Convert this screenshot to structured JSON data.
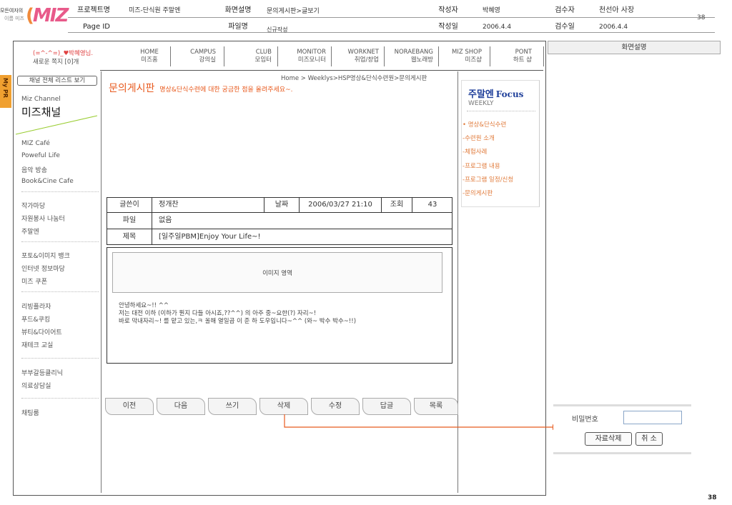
{
  "logo": {
    "line1": "모든여자의",
    "line2": "이름 미즈",
    "mark": "MIZ"
  },
  "spec": {
    "project_label": "프로젝트명",
    "project_value": "미즈-단식원 주말엔",
    "screen_label": "화면설명",
    "screen_value": "문의게시판>글보기",
    "author_label": "작성자",
    "author_value": "박혜영",
    "reviewer_label": "검수자",
    "reviewer_value": "천선아 사장",
    "page_id_label": "Page ID",
    "file_label": "파일명",
    "file_value": "신규작성",
    "date_label": "작성일",
    "date_value": "2006.4.4",
    "review_date_label": "검수일",
    "review_date_value": "2006.4.4",
    "page_number": "38"
  },
  "user": {
    "greeting": "(=^-^=)_♥박혜영님.",
    "messages": "새로운 쪽지 [0]개"
  },
  "nav": [
    {
      "en": "HOME",
      "ko": "미즈홈"
    },
    {
      "en": "CAMPUS",
      "ko": "강의실"
    },
    {
      "en": "CLUB",
      "ko": "모임터"
    },
    {
      "en": "MONITOR",
      "ko": "미즈모니터"
    },
    {
      "en": "WORKNET",
      "ko": "취업/창업"
    },
    {
      "en": "NORAEBANG",
      "ko": "웹노래방"
    },
    {
      "en": "MIZ SHOP",
      "ko": "미즈샵"
    },
    {
      "en": "PONT",
      "ko": "하트 샵"
    }
  ],
  "my_pr": "My PR",
  "channel_button": "채널 전체 리스트 보기",
  "channel": {
    "sub": "Miz Channel",
    "title": "미즈채널"
  },
  "sidebar": {
    "group1": [
      "MIZ Café",
      "Poweful Life",
      "음악 방송",
      "Book&Cine Cafe"
    ],
    "group2": [
      "작가마당",
      "자원봉사 나눔터",
      "주말엔"
    ],
    "group3": [
      "포토&이미지 뱅크",
      "인터넷 정보마당",
      "미즈 쿠폰"
    ],
    "group4": [
      "리빙플라자",
      "푸드&쿠킹",
      "뷰티&다이어트",
      "재테크 교실"
    ],
    "group5": [
      "부부갈등클리닉",
      "의료상담실"
    ],
    "group6": [
      "채팅룸"
    ]
  },
  "breadcrumb": "Home > Weeklys>HSP명상&단식수련원>문의게시판",
  "board": {
    "title": "문의게시판",
    "subtitle": "명상&단식수련에 대한 궁금한 점을 올려주세요~."
  },
  "post": {
    "author_label": "글쓴이",
    "author": "정개찬",
    "date_label": "날짜",
    "date": "2006/03/27 21:10",
    "views_label": "조회",
    "views": "43",
    "file_label": "파일",
    "file": "없음",
    "subject_label": "제목",
    "subject": "[일주일PBM]Enjoy Your Life~!",
    "image_area": "이미지 영역",
    "body": [
      "안녕하세요~!! ^^",
      "저는 대전 이하 (이하가 뭔지 다들 아시죠,??^^) 의 아주 중~요한(?) 자리~!",
      "바로 막내자리~! 를 맡고 있는,ㅋ 올해 열일곱 이 준 하 도우입니다~^^ (와~ 박수 박수~!!)"
    ]
  },
  "buttons": [
    "이전",
    "다음",
    "쓰기",
    "삭제",
    "수정",
    "답글",
    "목록"
  ],
  "focus": {
    "title_ko": "주말엔",
    "title_en": "Focus",
    "sub": "WEEKLY",
    "links": [
      "• 명상&단식수련",
      "-수련원 소개",
      "-체험사례",
      "-프로그램 내용",
      "-프로그램 일정/신청",
      "-문의게시판"
    ]
  },
  "desc_panel": {
    "title": "화면설명"
  },
  "delete_popup": {
    "label": "비밀번호",
    "input_value": "",
    "confirm": "자료삭제",
    "cancel": "취 소"
  },
  "footer_page": "38",
  "colors": {
    "accent": "#e85a1e",
    "orange_link": "#e07a3a",
    "focus_blue": "#1f3f9a",
    "my_pr_bg": "#f0a030",
    "panel_bg": "#f0f0f0"
  }
}
